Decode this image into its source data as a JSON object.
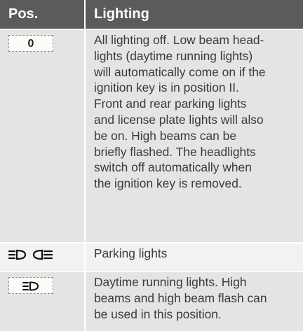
{
  "header": {
    "col1": "Pos.",
    "col2": "Lighting"
  },
  "rows": [
    {
      "position_label": "0",
      "icon": "knob-position-0",
      "description_lines": [
        "All lighting off. Low beam head-",
        "lights (daytime running lights)",
        "will automatically come on if the",
        "ignition key is in position II.",
        "Front and rear parking lights",
        "and license plate lights will also",
        "be on. High beams can be",
        "briefly flashed. The headlights",
        "switch off automatically when",
        "the ignition key is removed."
      ]
    },
    {
      "icon": "parking-lights-icon",
      "description_lines": [
        "Parking lights"
      ]
    },
    {
      "icon": "daytime-running-lights-icon",
      "description_lines": [
        "Daytime running lights. High",
        "beams and high beam flash can",
        "be used in this position."
      ]
    }
  ]
}
